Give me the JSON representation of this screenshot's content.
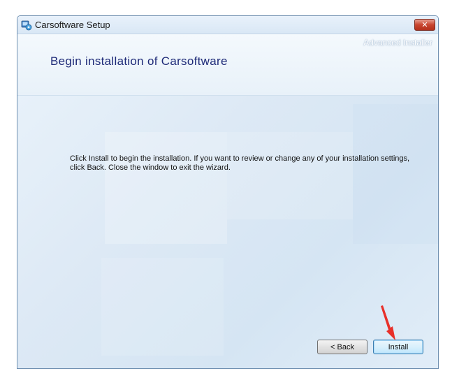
{
  "window": {
    "title": "Carsoftware Setup",
    "close_glyph": "✕"
  },
  "header": {
    "brand": "Advanced Installer",
    "heading": "Begin installation of Carsoftware"
  },
  "content": {
    "line1": "Click Install to begin the installation.  If you want to review or change any of your installation settings,",
    "line2": "click Back.  Close the window to exit the wizard."
  },
  "buttons": {
    "back_label": "< Back",
    "install_label": "Install"
  },
  "colors": {
    "accent": "#1e2a78",
    "annotation_arrow": "#e8302a"
  },
  "icons": [
    "setup-app-icon",
    "close-icon",
    "annotation-arrow-icon"
  ]
}
